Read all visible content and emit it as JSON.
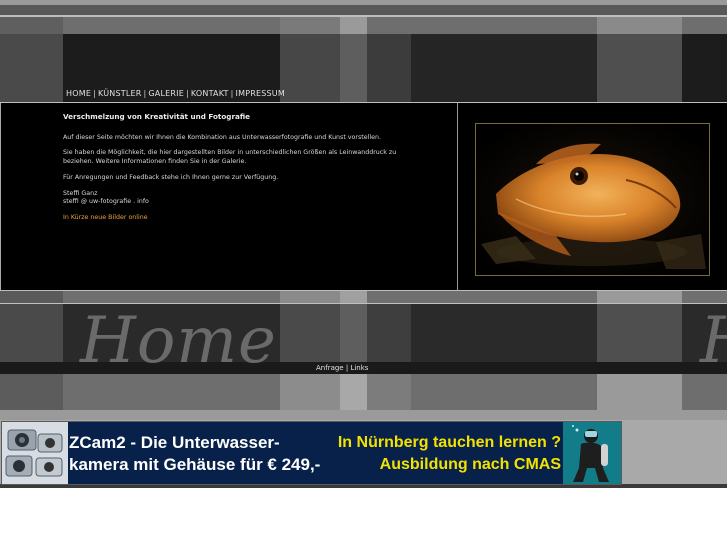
{
  "nav": {
    "items": [
      "HOME",
      "KÜNSTLER",
      "GALERIE",
      "KONTAKT",
      "IMPRESSUM"
    ],
    "separator": "|"
  },
  "content": {
    "title": "Verschmelzung von Kreativität und Fotografie",
    "p1": "Auf dieser Seite möchten wir Ihnen die Kombination aus Unterwasserfotografie und Kunst vorstellen.",
    "p2": "Sie haben die Möglichkeit, die hier dargestellten Bilder in unterschiedlichen Größen als Leinwanddruck zu beziehen. Weitere Informationen finden Sie in der Galerie.",
    "p3": "Für Anregungen und Feedback stehe ich Ihnen gerne zur Verfügung.",
    "name": "Steffi Ganz",
    "email": "steffi @ uw-fotografie . info",
    "notice": "In Kürze neue Bilder online"
  },
  "decor": {
    "home_script": "Home",
    "home_script_partial": "H"
  },
  "footer": {
    "links": [
      "Anfrage",
      "Links"
    ],
    "separator": "|"
  },
  "banner": {
    "left_line1": "ZCam2 - Die Unterwasser-",
    "left_line2": "kamera mit Gehäuse für € 249,-",
    "right_line1": "In Nürnberg tauchen lernen ?",
    "right_line2": "Ausbildung nach CMAS"
  },
  "colors": {
    "background": "#000000",
    "accent_orange": "#e8a33c",
    "banner_bg": "#08214a",
    "banner_yellow": "#f2e200"
  }
}
